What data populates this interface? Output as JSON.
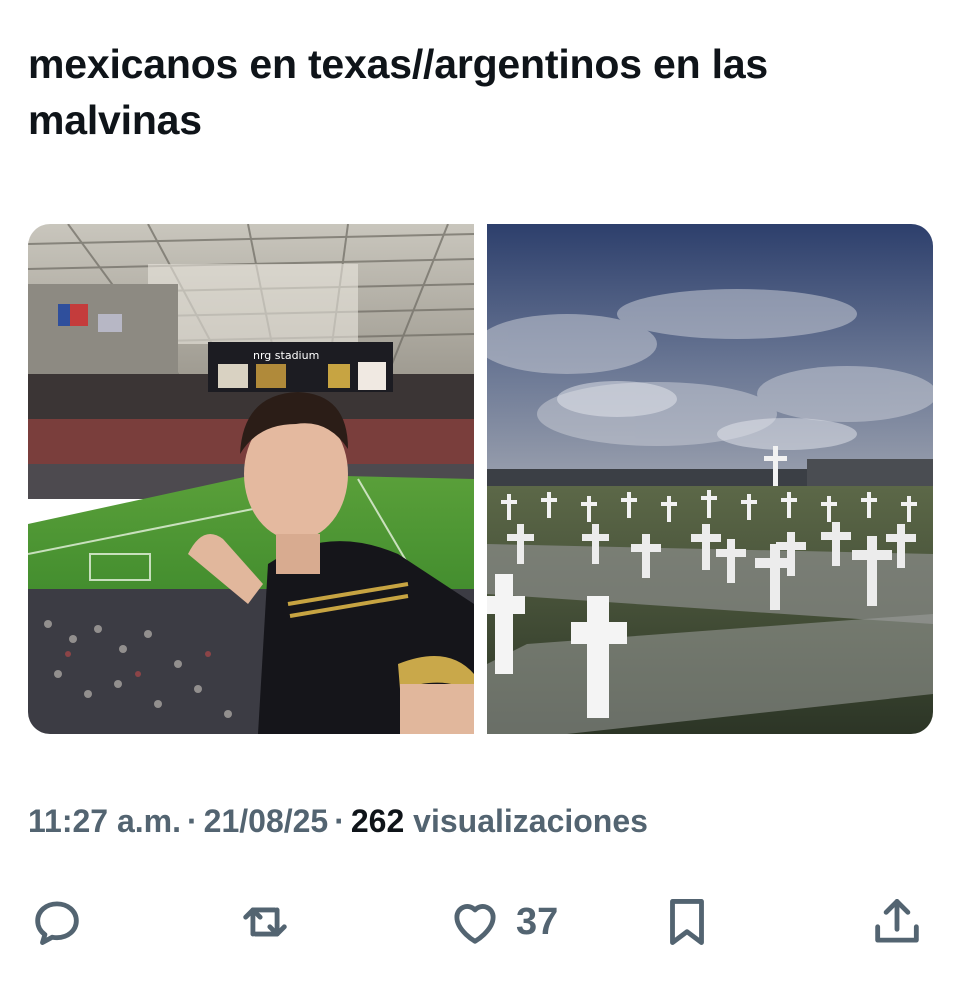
{
  "tweet": {
    "text": "mexicanos en texas//argentinos en las malvinas"
  },
  "media": [
    {
      "alt": "Selfie en el estadio NRG Stadium",
      "stadium_sign": "nrg stadium"
    },
    {
      "alt": "Cementerio con cruces blancas"
    }
  ],
  "meta": {
    "time": "11:27 a.m.",
    "date": "21/08/25",
    "views_count": "262",
    "views_label": "visualizaciones"
  },
  "actions": {
    "reply_icon": "reply-icon",
    "repost_icon": "repost-icon",
    "like_icon": "heart-icon",
    "like_count": "37",
    "bookmark_icon": "bookmark-icon",
    "share_icon": "share-icon"
  },
  "colors": {
    "text_primary": "#0f1419",
    "text_secondary": "#536471"
  }
}
